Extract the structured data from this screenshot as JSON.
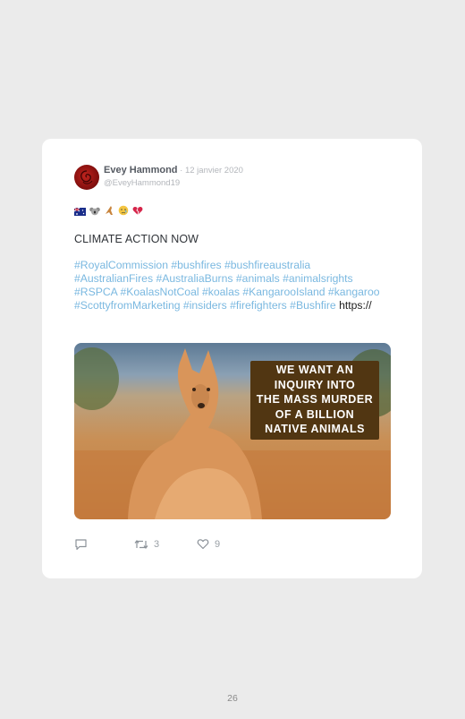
{
  "tweet": {
    "author_name": "Evey Hammond",
    "date": " · 12 janvier 2020",
    "handle": "@EveyHammond19",
    "emojis": [
      "australia-flag-emoji",
      "koala-emoji",
      "kangaroo-emoji",
      "crying-face-emoji",
      "broken-heart-emoji"
    ],
    "text_line": "CLIMATE ACTION NOW",
    "hashtags": [
      "#RoyalCommission",
      "#bushfires",
      "#bushfireaustralia",
      "#AustralianFires",
      "#AustraliaBurns",
      "#animals",
      "#animalsrights",
      "#RSPCA",
      "#KoalasNotCoal",
      "#koalas",
      "#KangarooIsland",
      "#kangaroo",
      "#ScottyfromMarketing",
      "#insiders",
      "#firefighters",
      "#Bushfire"
    ],
    "link": "https://",
    "image_text": [
      "WE WANT AN",
      "INQUIRY INTO",
      "THE MASS MURDER",
      "OF A BILLION",
      "NATIVE ANIMALS"
    ],
    "retweets": "3",
    "likes": "9"
  },
  "colors": {
    "hashtag": "#7ab8e0",
    "sign_background": "#513612",
    "avatar": "#8c1210"
  },
  "page_number": "26"
}
